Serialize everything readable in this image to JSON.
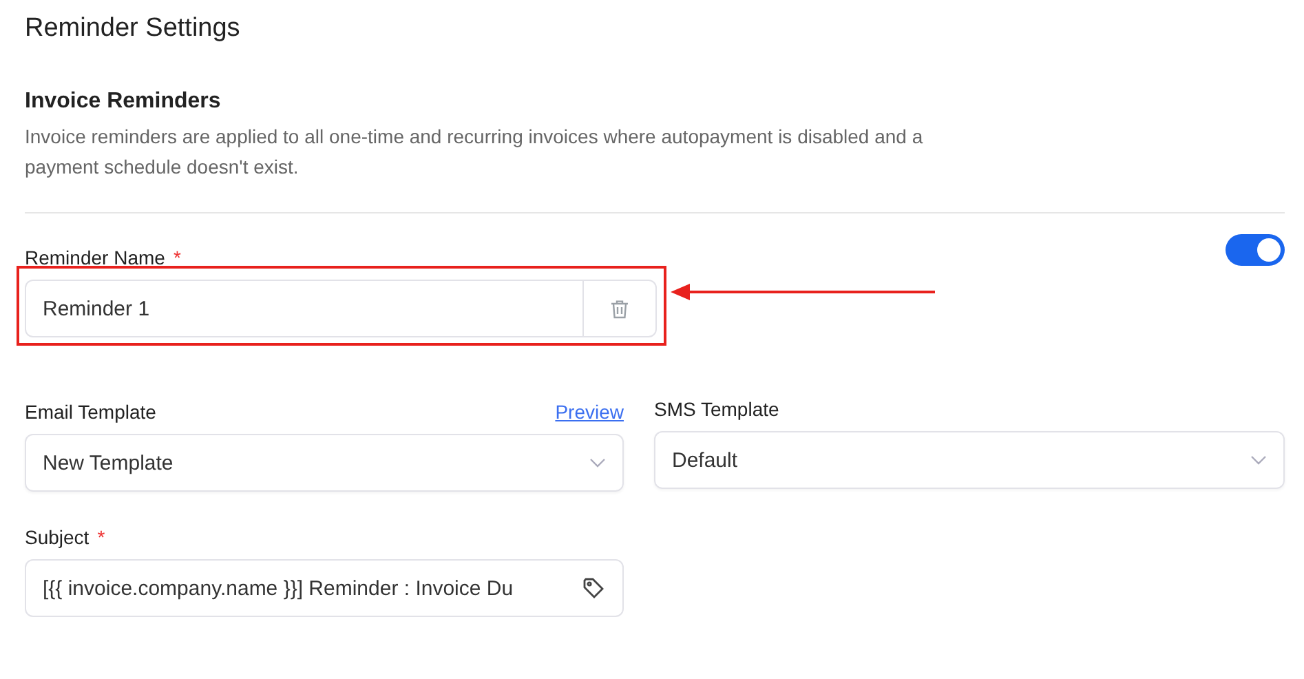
{
  "page_title": "Reminder Settings",
  "section": {
    "title": "Invoice Reminders",
    "description": "Invoice reminders are applied to all one-time and recurring invoices where autopayment is disabled and a payment schedule doesn't exist."
  },
  "reminder": {
    "label": "Reminder Name",
    "required_mark": "*",
    "value": "Reminder 1",
    "enabled": true,
    "highlighted": true
  },
  "email_template": {
    "label": "Email Template",
    "link": "Preview",
    "value": "New Template"
  },
  "sms_template": {
    "label": "SMS Template",
    "value": "Default"
  },
  "subject": {
    "label": "Subject",
    "required_mark": "*",
    "value": "[{{ invoice.company.name }}] Reminder : Invoice Du"
  }
}
